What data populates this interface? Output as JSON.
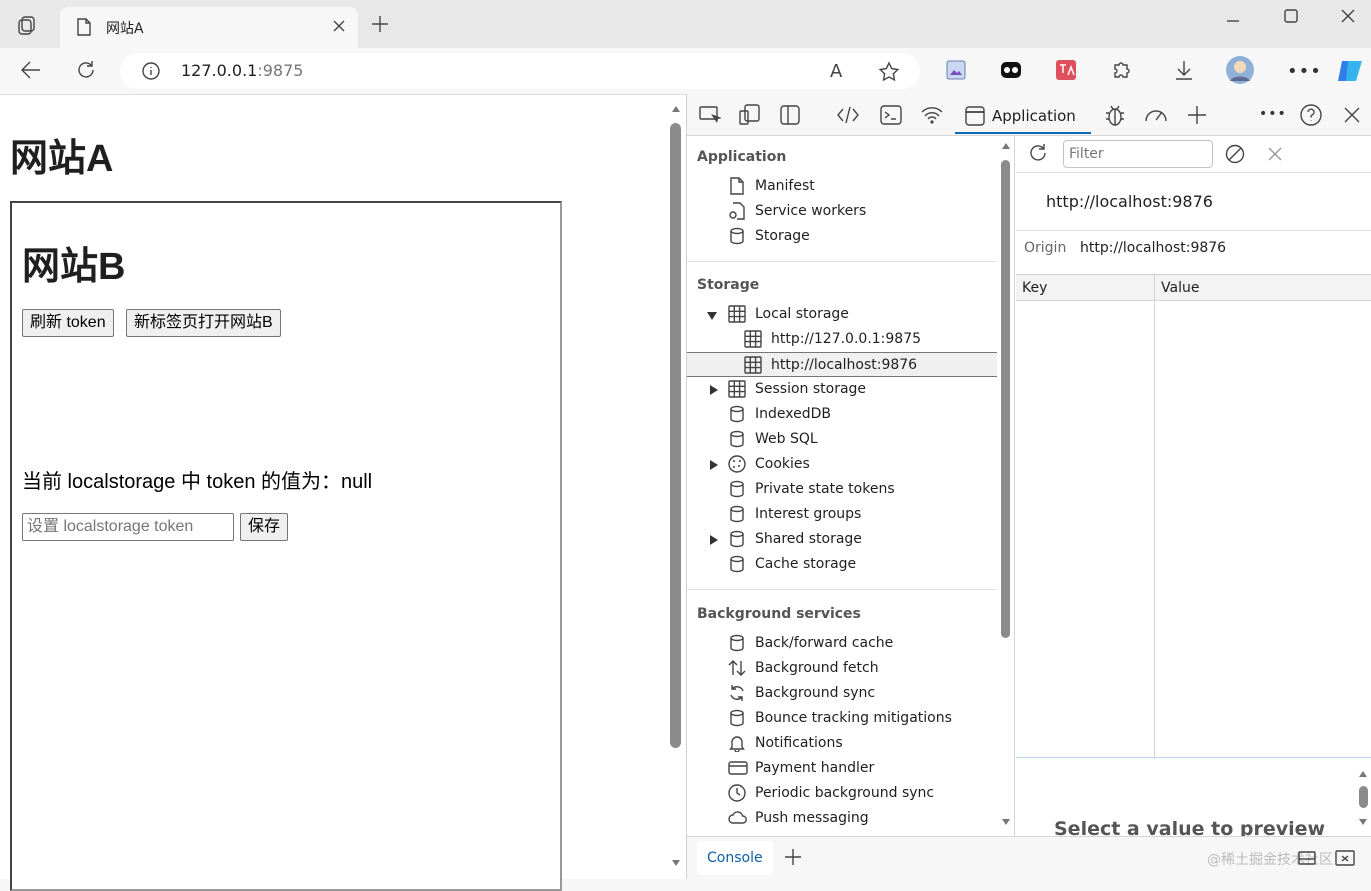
{
  "browser": {
    "tab_title": "网站A",
    "url_host": "127.0.0.1",
    "url_port": ":9875",
    "read_aloud_label": "A"
  },
  "page": {
    "site_a_title": "网站A",
    "site_b_title": "网站B",
    "refresh_button": "刷新 token",
    "open_tab_button": "新标签页打开网站B",
    "token_line": "当前 localstorage 中 token 的值为：null",
    "token_placeholder": "设置 localstorage token",
    "save_button": "保存"
  },
  "devtools": {
    "active_tab": "Application",
    "sidebar": {
      "application_header": "Application",
      "application_items": [
        "Manifest",
        "Service workers",
        "Storage"
      ],
      "storage_header": "Storage",
      "local_storage": "Local storage",
      "local_storage_origins": [
        "http://127.0.0.1:9875",
        "http://localhost:9876"
      ],
      "storage_items": [
        "Session storage",
        "IndexedDB",
        "Web SQL",
        "Cookies",
        "Private state tokens",
        "Interest groups",
        "Shared storage",
        "Cache storage"
      ],
      "background_header": "Background services",
      "background_items": [
        "Back/forward cache",
        "Background fetch",
        "Background sync",
        "Bounce tracking mitigations",
        "Notifications",
        "Payment handler",
        "Periodic background sync",
        "Push messaging"
      ]
    },
    "right": {
      "filter_placeholder": "Filter",
      "origin_heading": "http://localhost:9876",
      "origin_label": "Origin",
      "origin_value": "http://localhost:9876",
      "key_col": "Key",
      "value_col": "Value",
      "preview_text": "Select a value to preview"
    },
    "drawer": {
      "console_tab": "Console",
      "watermark": "@稀土掘金技术社区"
    }
  }
}
